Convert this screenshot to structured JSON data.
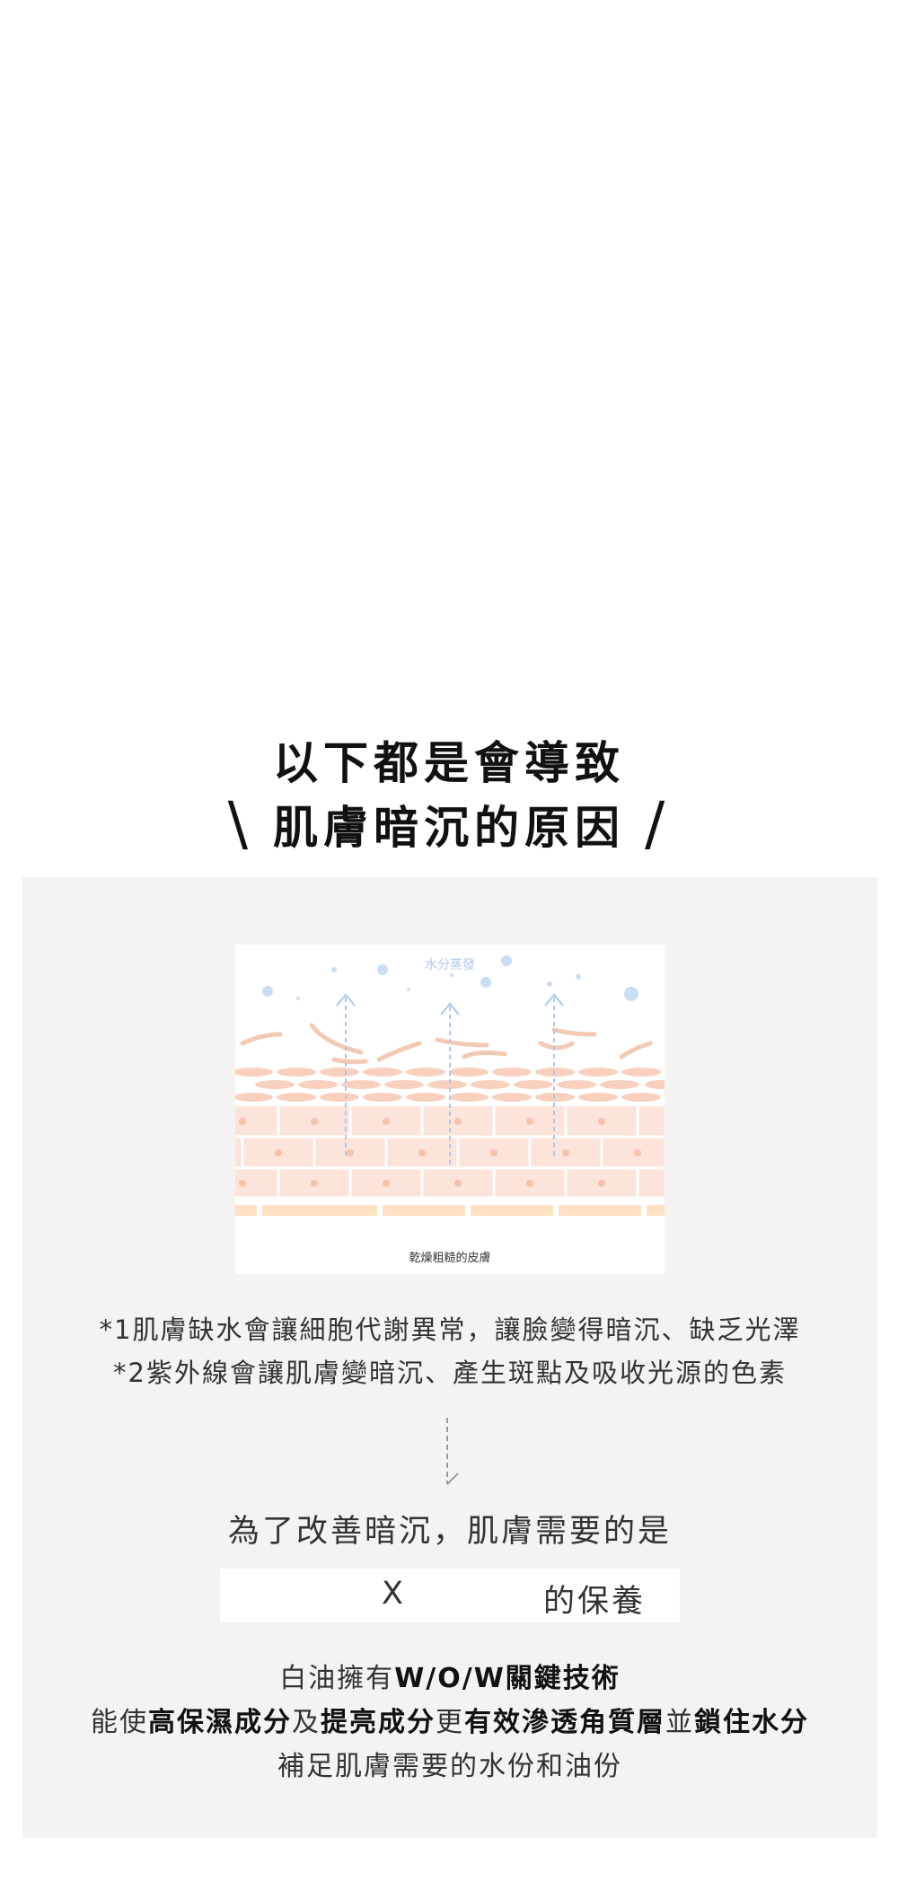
{
  "headline": {
    "line1": "以下都是會導致",
    "line2": "肌膚暗沉的原因",
    "left_mark": "\\",
    "right_mark": "/"
  },
  "illustration": {
    "top_label": "水分蒸發",
    "caption": "乾燥粗糙的皮膚",
    "colors": {
      "water": "#a9c9ee",
      "skin_light": "#fde3d9",
      "skin_mid": "#f9cdbb",
      "flake": "#f3c1a8",
      "base": "#fde2c4"
    }
  },
  "notes": [
    "*1肌膚缺水會讓細胞代謝異常，讓臉變得暗沉、缺乏光澤",
    "*2紫外線會讓肌膚變暗沉、產生斑點及吸收光源的色素"
  ],
  "question": "為了改善暗沉，肌膚需要的是",
  "answer": {
    "x": "X",
    "suffix": "的保養"
  },
  "desc": {
    "line1": {
      "a": "白油擁有",
      "b": "W/O/W關鍵技術"
    },
    "line2": {
      "a": "能使",
      "b": "高保濕成分",
      "c": "及",
      "d": "提亮成分",
      "e": "更",
      "f": "有效滲透角質層",
      "g": "並",
      "h": "鎖住水分"
    },
    "line3": "補足肌膚需要的水份和油份"
  }
}
